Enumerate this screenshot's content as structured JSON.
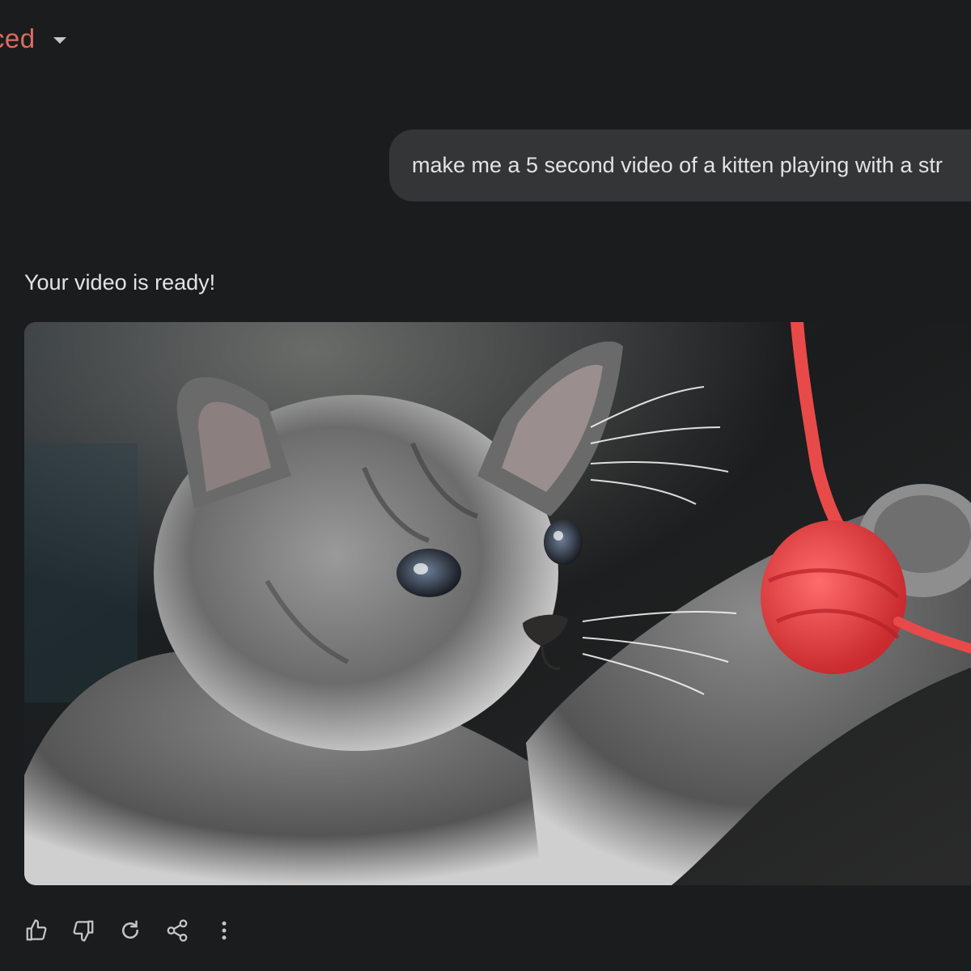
{
  "header": {
    "model_label": "nced",
    "model_dropdown_icon": "caret-down-icon"
  },
  "conversation": {
    "user_prompt": "make me a 5 second video of a kitten playing with a str",
    "response_text": "Your video is ready!",
    "video_icon": "video-thumbnail"
  },
  "actions": [
    {
      "icon": "thumbs-up-icon"
    },
    {
      "icon": "thumbs-down-icon"
    },
    {
      "icon": "redo-icon"
    },
    {
      "icon": "share-icon"
    },
    {
      "icon": "more-vertical-icon"
    }
  ],
  "colors": {
    "background": "#1b1c1d",
    "bubble": "#333537",
    "text": "#e3e3e3",
    "model_accent": "#e06a5e",
    "icon": "#c4c7c5",
    "yarn": "#e84a4a"
  }
}
